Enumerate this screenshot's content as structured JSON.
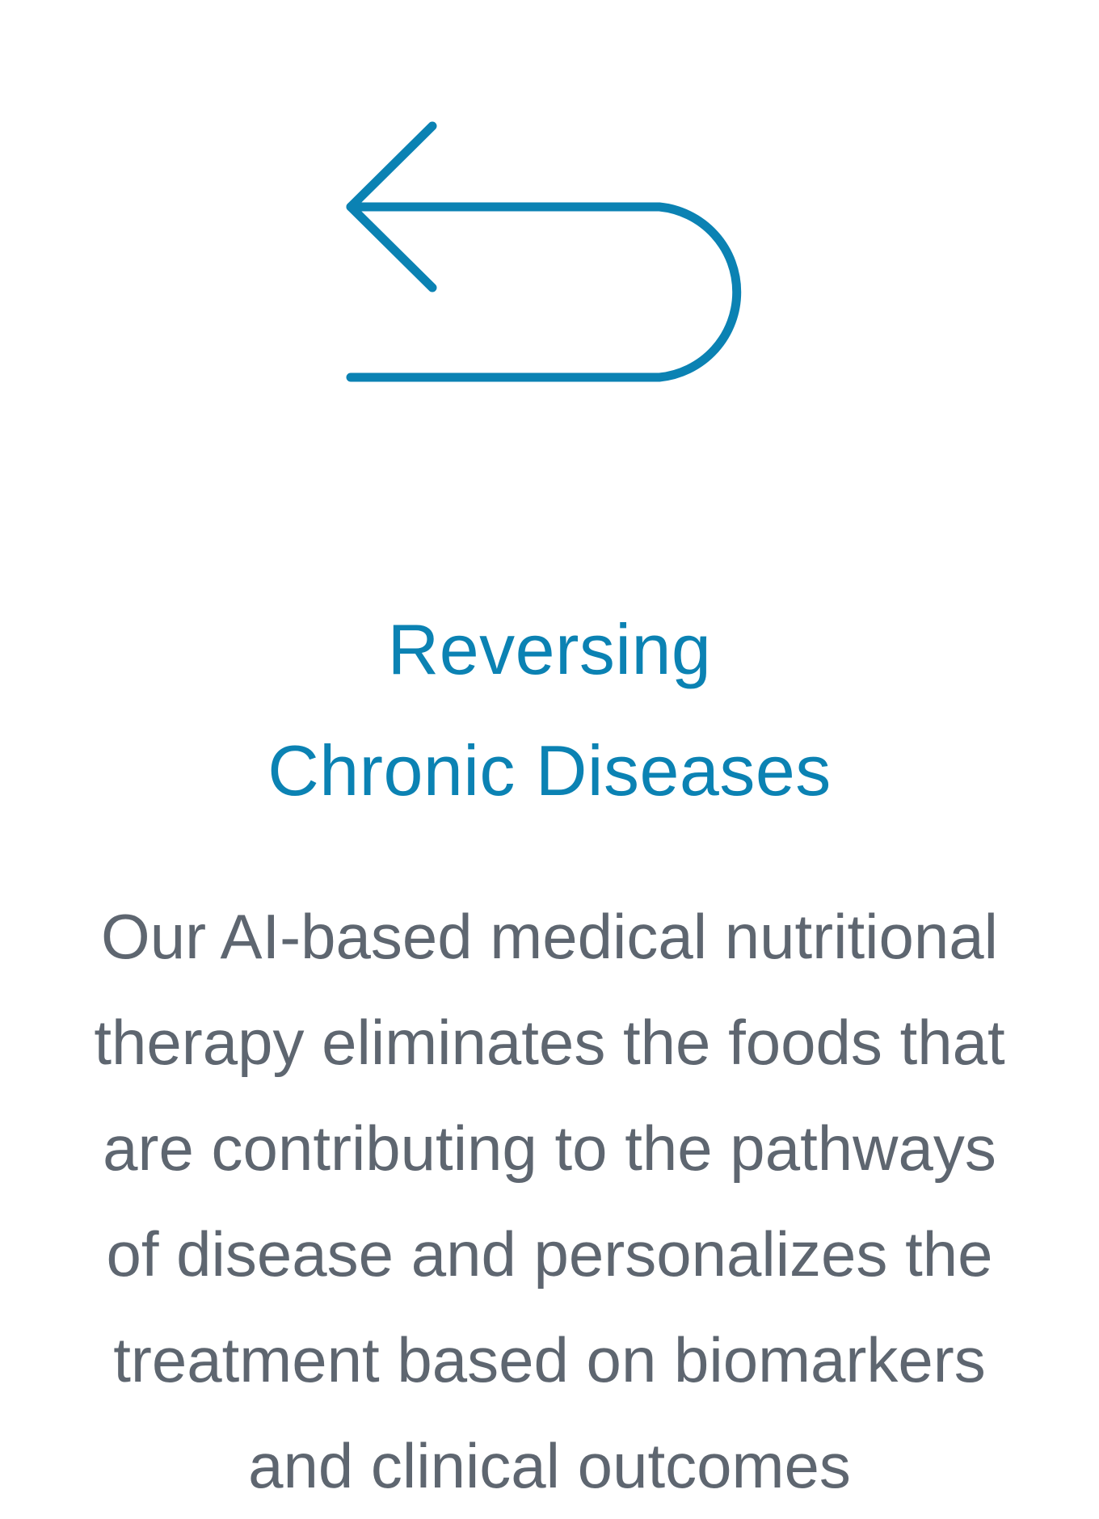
{
  "colors": {
    "accent": "#0b82b3",
    "body_text": "#5e6670",
    "background": "#ffffff"
  },
  "icon": {
    "name": "u-turn-left-arrow-icon"
  },
  "heading": {
    "lines": [
      "Reversing",
      "Chronic Diseases"
    ]
  },
  "description": {
    "lines": [
      "Our AI-based medical nutritional",
      "therapy eliminates the foods that",
      "are contributing to the pathways",
      "of disease and personalizes the",
      "treatment based on biomarkers",
      "and clinical outcomes"
    ]
  }
}
